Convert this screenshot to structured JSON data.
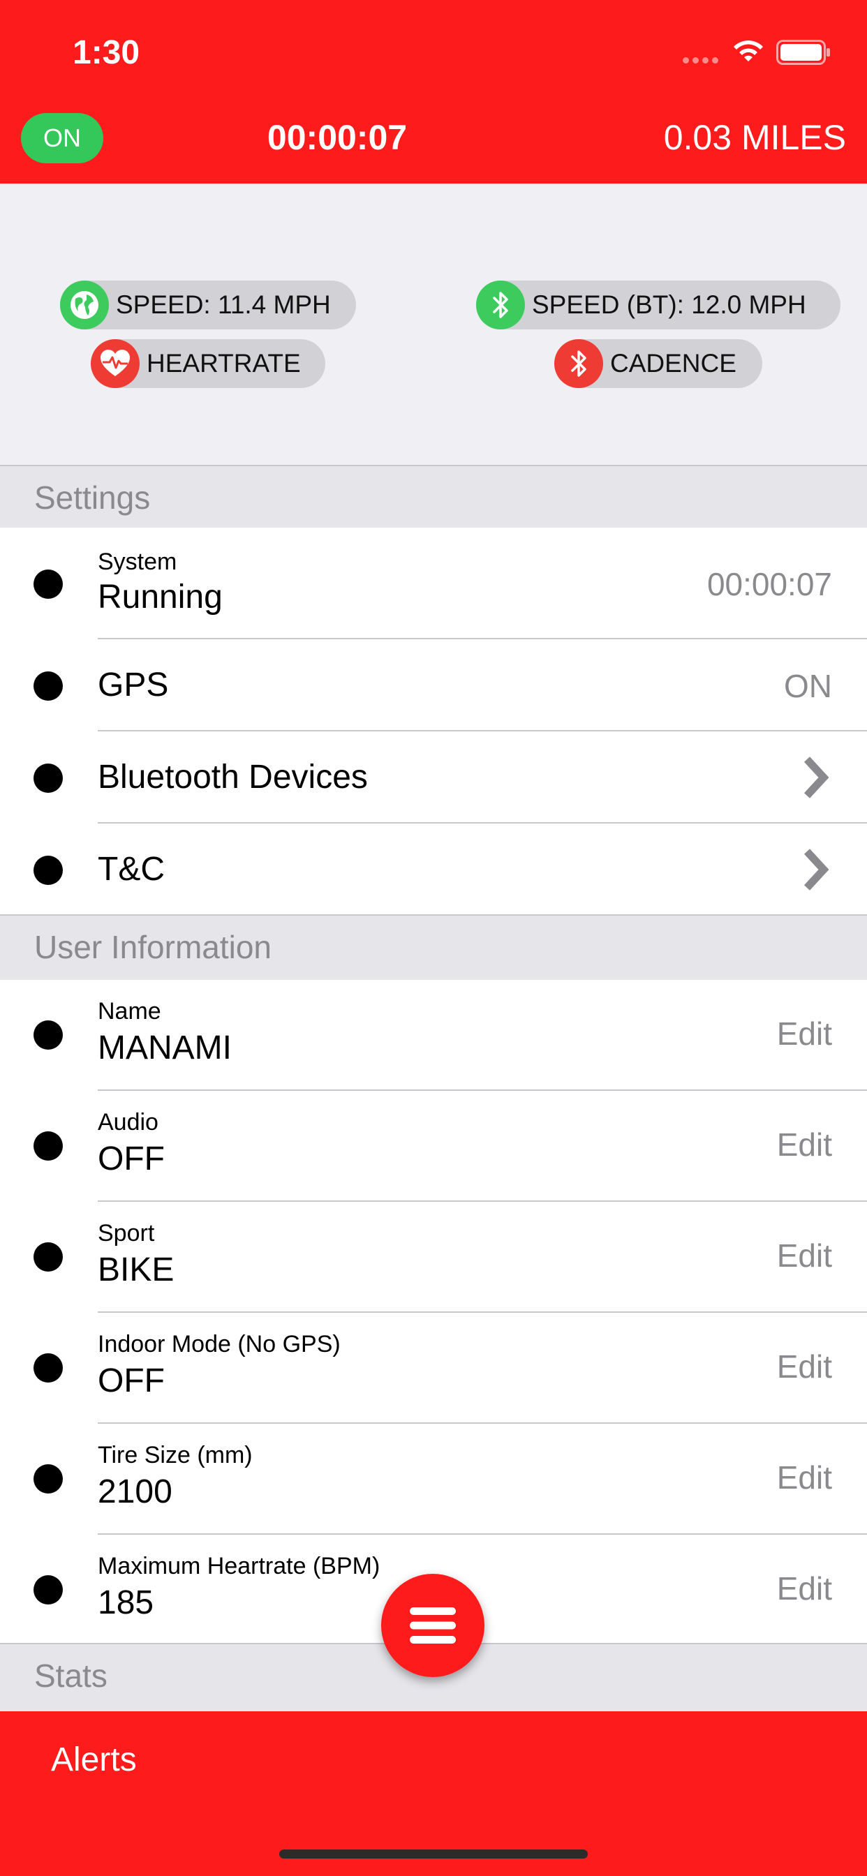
{
  "status_bar": {
    "time": "1:30"
  },
  "header": {
    "toggle_label": "ON",
    "elapsed_time": "00:00:07",
    "distance": "0.03 MILES"
  },
  "sensors": [
    {
      "label": "SPEED: 11.4 MPH",
      "icon": "globe-icon",
      "status_color": "#3ecb5e"
    },
    {
      "label": "SPEED (BT): 12.0 MPH",
      "icon": "bluetooth-icon",
      "status_color": "#3ecb5e"
    },
    {
      "label": "HEARTRATE",
      "icon": "heart-pulse-icon",
      "status_color": "#ee3b33"
    },
    {
      "label": "CADENCE",
      "icon": "bluetooth-icon",
      "status_color": "#ee3b33"
    }
  ],
  "settings": {
    "title": "Settings",
    "system": {
      "sublabel": "System",
      "value": "Running",
      "detail": "00:00:07"
    },
    "gps": {
      "label": "GPS",
      "detail": "ON"
    },
    "bluetooth": {
      "label": "Bluetooth Devices"
    },
    "tc": {
      "label": "T&C"
    }
  },
  "user_info": {
    "title": "User Information",
    "rows": [
      {
        "sublabel": "Name",
        "value": "MANAMI",
        "action": "Edit"
      },
      {
        "sublabel": "Audio",
        "value": "OFF",
        "action": "Edit"
      },
      {
        "sublabel": "Sport",
        "value": "BIKE",
        "action": "Edit"
      },
      {
        "sublabel": "Indoor Mode (No GPS)",
        "value": "OFF",
        "action": "Edit"
      },
      {
        "sublabel": "Tire Size (mm)",
        "value": "2100",
        "action": "Edit"
      },
      {
        "sublabel": "Maximum Heartrate (BPM)",
        "value": "185",
        "action": "Edit"
      }
    ]
  },
  "stats": {
    "title": "Stats"
  },
  "footer": {
    "alerts_label": "Alerts"
  },
  "colors": {
    "brand_red": "#fe1b1c",
    "toggle_green": "#34c759",
    "secondary_text": "#8a8a8e"
  }
}
